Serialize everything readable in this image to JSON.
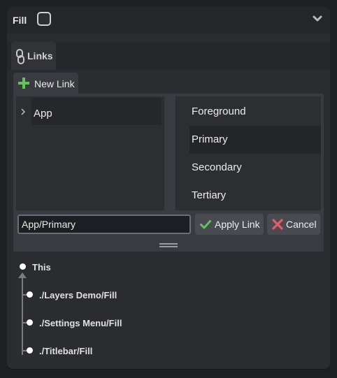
{
  "header": {
    "title": "Fill",
    "checkbox_checked": false,
    "collapse_icon": "chevron-down-icon"
  },
  "tabs": [
    {
      "label": "Links",
      "icon": "link-icon",
      "active": true
    }
  ],
  "link_editor": {
    "new_link_label": "New Link",
    "tree_items": [
      {
        "label": "App",
        "expanded": false
      }
    ],
    "options": [
      {
        "label": "Foreground",
        "selected": false
      },
      {
        "label": "Primary",
        "selected": true
      },
      {
        "label": "Secondary",
        "selected": false
      },
      {
        "label": "Tertiary",
        "selected": false
      }
    ],
    "path_value": "App/Primary",
    "apply_label": "Apply Link",
    "cancel_label": "Cancel"
  },
  "reference_tree": {
    "root_label": "This",
    "children": [
      {
        "label": "./Layers Demo/Fill"
      },
      {
        "label": "./Settings Menu/Fill"
      },
      {
        "label": "./Titlebar/Fill"
      }
    ]
  },
  "colors": {
    "background": "#1f2023",
    "panel": "#2b2c30",
    "accent_green": "#62c35b",
    "cancel_red": "#e35a6a"
  }
}
